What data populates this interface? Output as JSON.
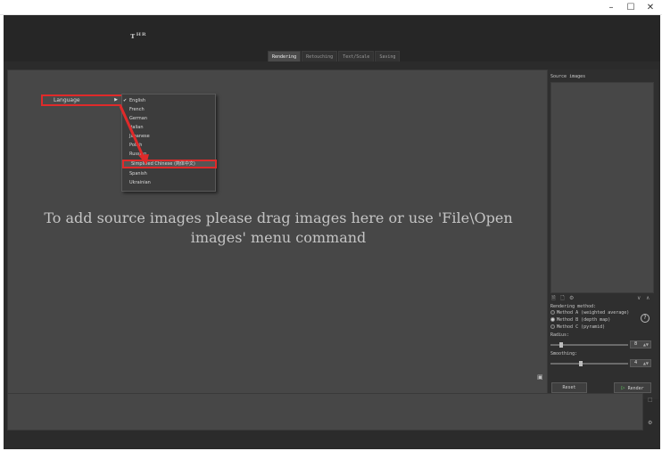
{
  "window": {
    "controls": {
      "minimize": "–",
      "maximize": "☐",
      "close": "✕"
    }
  },
  "toolbar": {
    "brand": "ᴛᴴᴿ",
    "tabs": [
      {
        "label": "Rendering",
        "active": true
      },
      {
        "label": "Retouching",
        "active": false
      },
      {
        "label": "Text/Scale",
        "active": false
      },
      {
        "label": "Saving",
        "active": false
      }
    ]
  },
  "canvas": {
    "hint_line1": "To add source images please drag images here or use 'File\\Open",
    "hint_line2": "images' menu command"
  },
  "language_menu": {
    "button_label": "Language",
    "button_arrow": "▶",
    "items": [
      {
        "label": "English",
        "checked": true,
        "highlight": false
      },
      {
        "label": "French",
        "checked": false,
        "highlight": false
      },
      {
        "label": "German",
        "checked": false,
        "highlight": false
      },
      {
        "label": "Italian",
        "checked": false,
        "highlight": false
      },
      {
        "label": "Japanese",
        "checked": false,
        "highlight": false
      },
      {
        "label": "Polish",
        "checked": false,
        "highlight": false
      },
      {
        "label": "Russian",
        "checked": false,
        "highlight": false
      },
      {
        "label": "Simplified Chinese (简体中文)",
        "checked": false,
        "highlight": true
      },
      {
        "label": "Spanish",
        "checked": false,
        "highlight": false
      },
      {
        "label": "Ukrainian",
        "checked": false,
        "highlight": false
      }
    ]
  },
  "panel": {
    "source_images_label": "Source images",
    "icons": {
      "add": "🗎",
      "remove": "🗋",
      "settings": "⚙",
      "down": "∨",
      "up": "∧"
    },
    "rendering_method_label": "Rendering method:",
    "methods": [
      {
        "label": "Method A (weighted average)",
        "selected": false
      },
      {
        "label": "Method B (depth map)",
        "selected": true
      },
      {
        "label": "Method C (pyramid)",
        "selected": false
      }
    ],
    "help": "?",
    "radius_label": "Radius:",
    "radius_value": "8",
    "radius_fraction": 0.12,
    "smoothing_label": "Smoothing:",
    "smoothing_value": "4",
    "smoothing_fraction": 0.38,
    "reset_label": "Reset",
    "render_label": "Render",
    "render_icon": "▷"
  },
  "colors": {
    "accent_red": "#e02a2a",
    "render_green": "#5bbf5b"
  }
}
